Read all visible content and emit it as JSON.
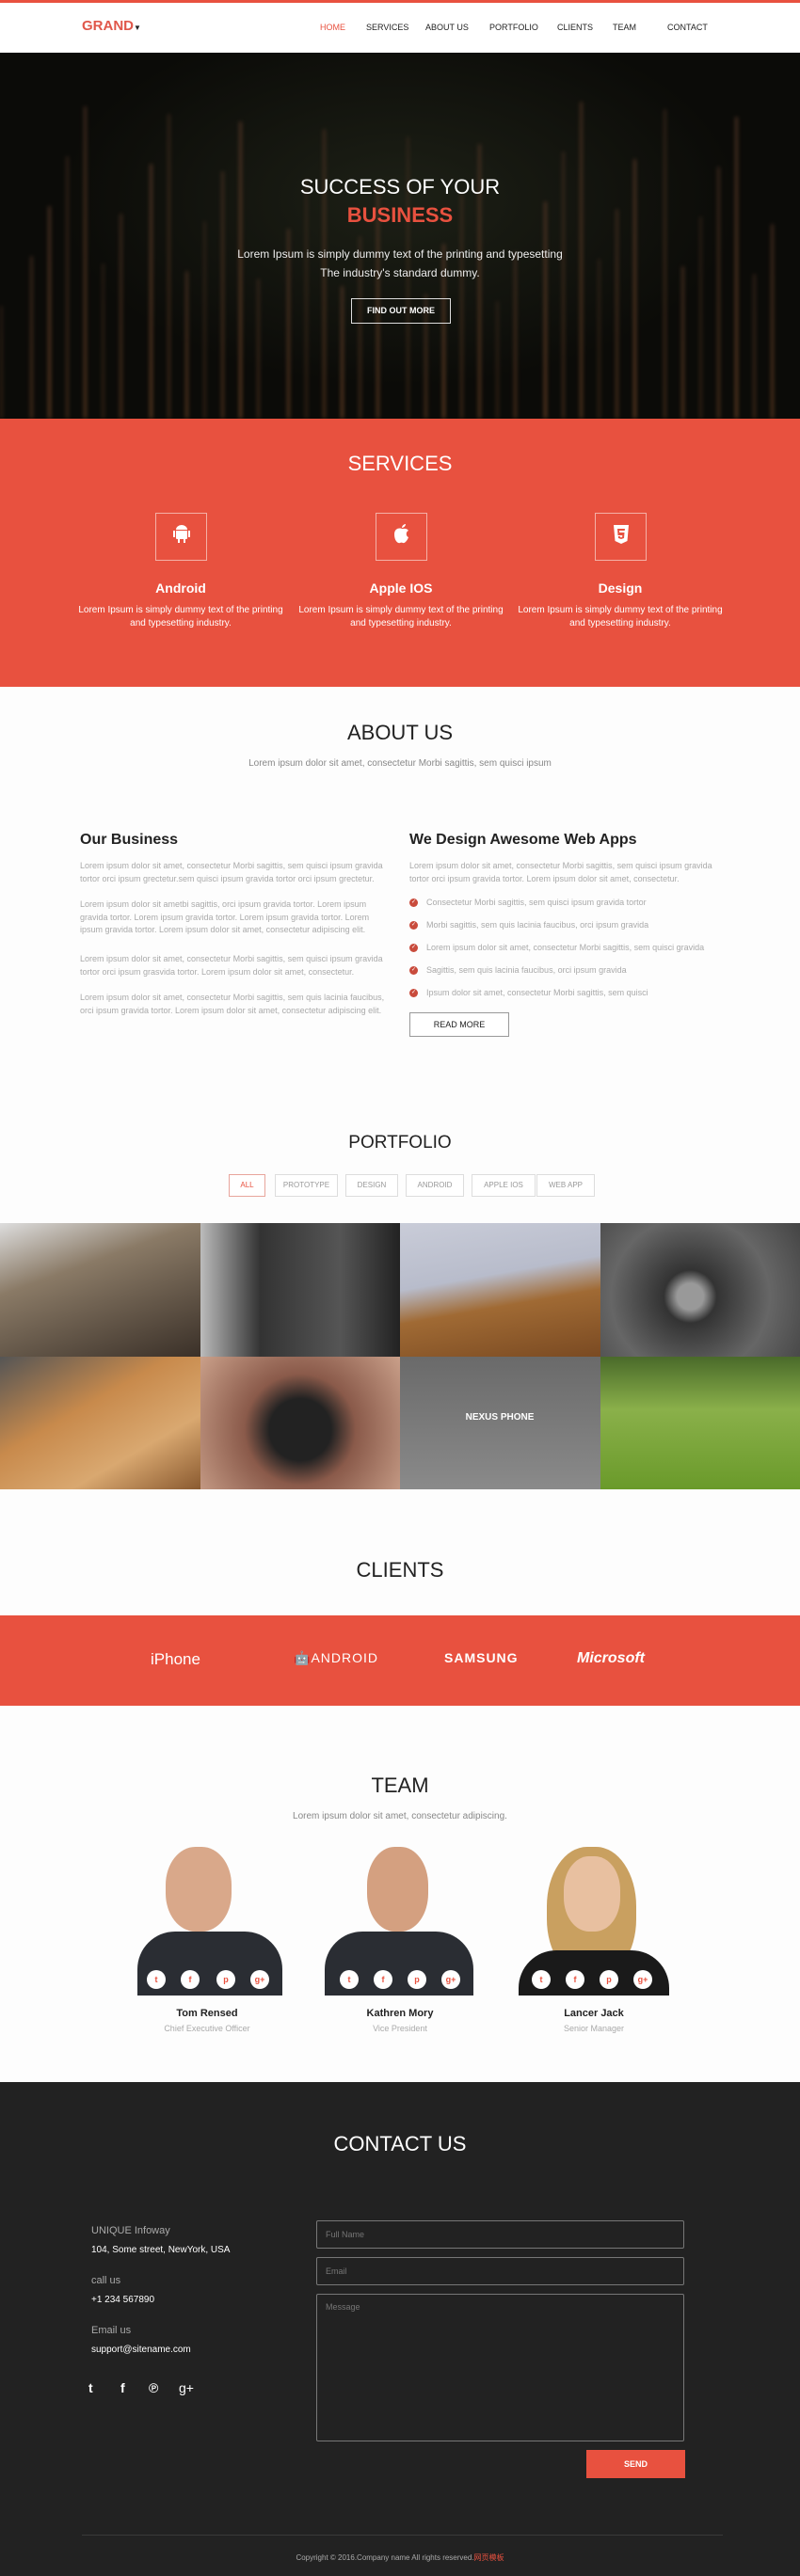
{
  "nav": {
    "logo": "GRAND",
    "items": [
      "HOME",
      "SERVICES",
      "ABOUT US",
      "PORTFOLIO",
      "CLIENTS",
      "TEAM",
      "CONTACT"
    ],
    "active": "HOME"
  },
  "hero": {
    "title": "SUCCESS OF YOUR",
    "highlight": "BUSINESS",
    "line1": "Lorem Ipsum is simply dummy text of the printing and typesetting",
    "line2": "The industry's standard dummy.",
    "button": "FIND OUT MORE"
  },
  "services": {
    "title": "SERVICES",
    "items": [
      {
        "icon": "android-icon",
        "glyph": "🤖",
        "title": "Android",
        "text": "Lorem Ipsum is simply dummy text of the printing and typesetting industry."
      },
      {
        "icon": "apple-icon",
        "glyph": "",
        "title": "Apple IOS",
        "text": "Lorem Ipsum is simply dummy text of the printing and typesetting industry."
      },
      {
        "icon": "html5-icon",
        "glyph": "5",
        "title": "Design",
        "text": "Lorem Ipsum is simply dummy text of the printing and typesetting industry."
      }
    ]
  },
  "about": {
    "title": "ABOUT US",
    "subtitle": "Lorem ipsum dolor sit amet, consectetur Morbi sagittis, sem quisci ipsum",
    "left": {
      "heading": "Our Business",
      "paras": [
        "Lorem ipsum dolor sit amet, consectetur Morbi sagittis, sem quisci ipsum gravida tortor orci ipsum grectetur.sem quisci ipsum gravida tortor orci ipsum grectetur.",
        "Lorem ipsum dolor sit ametbi sagittis, orci ipsum gravida tortor. Lorem ipsum gravida tortor. Lorem ipsum gravida tortor. Lorem ipsum gravida tortor. Lorem ipsum gravida tortor. Lorem ipsum dolor sit amet, consectetur adipiscing elit.",
        "Lorem ipsum dolor sit amet, consectetur Morbi sagittis, sem quisci ipsum gravida tortor orci ipsum grasvida tortor. Lorem ipsum dolor sit amet, consectetur.",
        "Lorem ipsum dolor sit amet, consectetur Morbi sagittis, sem quis lacinia faucibus, orci ipsum gravida tortor. Lorem ipsum dolor sit amet, consectetur adipiscing elit."
      ]
    },
    "right": {
      "heading": "We Design Awesome Web Apps",
      "para": "Lorem ipsum dolor sit amet, consectetur Morbi sagittis, sem quisci ipsum gravida tortor orci ipsum gravida tortor. Lorem ipsum dolor sit amet, consectetur.",
      "list": [
        "Consectetur Morbi sagittis, sem quisci ipsum gravida tortor",
        "Morbi sagittis, sem quis lacinia faucibus, orci ipsum gravida",
        "Lorem ipsum dolor sit amet, consectetur Morbi sagittis, sem quisci gravida",
        "Sagittis, sem quis lacinia faucibus, orci ipsum gravida",
        "Ipsum dolor sit amet, consectetur Morbi sagittis, sem quisci"
      ],
      "button": "READ MORE"
    }
  },
  "portfolio": {
    "title": "PORTFOLIO",
    "filters": [
      "ALL",
      "PROTOTYPE",
      "DESIGN",
      "ANDROID",
      "APPLE IOS",
      "WEB APP"
    ],
    "active_filter": "ALL",
    "hover_caption": "NEXUS PHONE"
  },
  "clients": {
    "title": "CLIENTS",
    "logos": [
      "iPhone",
      "ANDROID",
      "SAMSUNG",
      "Microsoft"
    ]
  },
  "team": {
    "title": "TEAM",
    "subtitle": "Lorem ipsum dolor sit amet, consectetur adipiscing.",
    "members": [
      {
        "name": "Tom Rensed",
        "role": "Chief Executive Officer"
      },
      {
        "name": "Kathren Mory",
        "role": "Vice President"
      },
      {
        "name": "Lancer Jack",
        "role": "Senior Manager"
      }
    ]
  },
  "contact": {
    "title": "CONTACT US",
    "company": "UNIQUE Infoway",
    "address": "104, Some street, NewYork, USA",
    "call_label": "call us",
    "phone": "+1 234 567890",
    "email_label": "Email us",
    "email": "support@sitename.com",
    "placeholders": {
      "name": "Full Name",
      "email": "Email",
      "message": "Message"
    },
    "send": "SEND"
  },
  "footer": {
    "copyright": "Copyright © 2016.Company name All rights reserved.",
    "link": "网页模板"
  },
  "colors": {
    "accent": "#e8513f",
    "dark": "#222222"
  }
}
